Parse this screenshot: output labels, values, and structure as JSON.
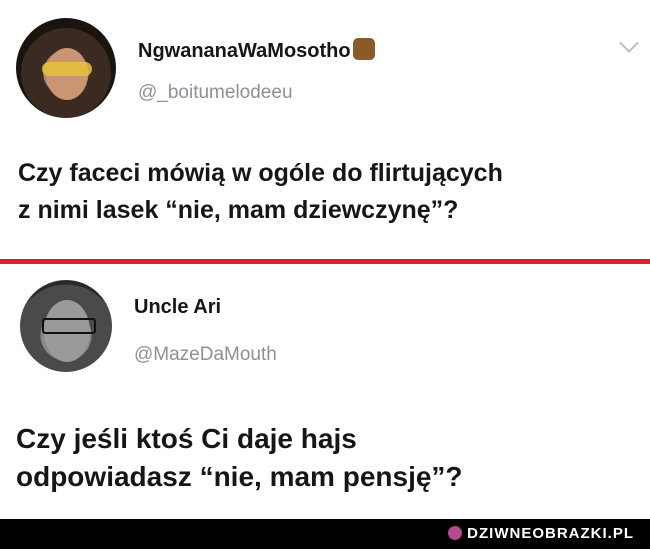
{
  "tweet1": {
    "display_name": "NgwananaWaMosotho",
    "handle": "@_boitumelodeeu",
    "text_line1": "Czy faceci mówią w ogóle do flirtujących",
    "text_line2": "z nimi lasek “nie, mam dziewczynę”?"
  },
  "tweet2": {
    "display_name": "Uncle Ari",
    "handle": "@MazeDaMouth",
    "text_line1": "Czy jeśli ktoś Ci daje hajs",
    "text_line2": "odpowiadasz “nie, mam pensję”?"
  },
  "divider_color": "#d6232a",
  "footer": {
    "watermark": "DZIWNEOBRAZKI.PL"
  }
}
